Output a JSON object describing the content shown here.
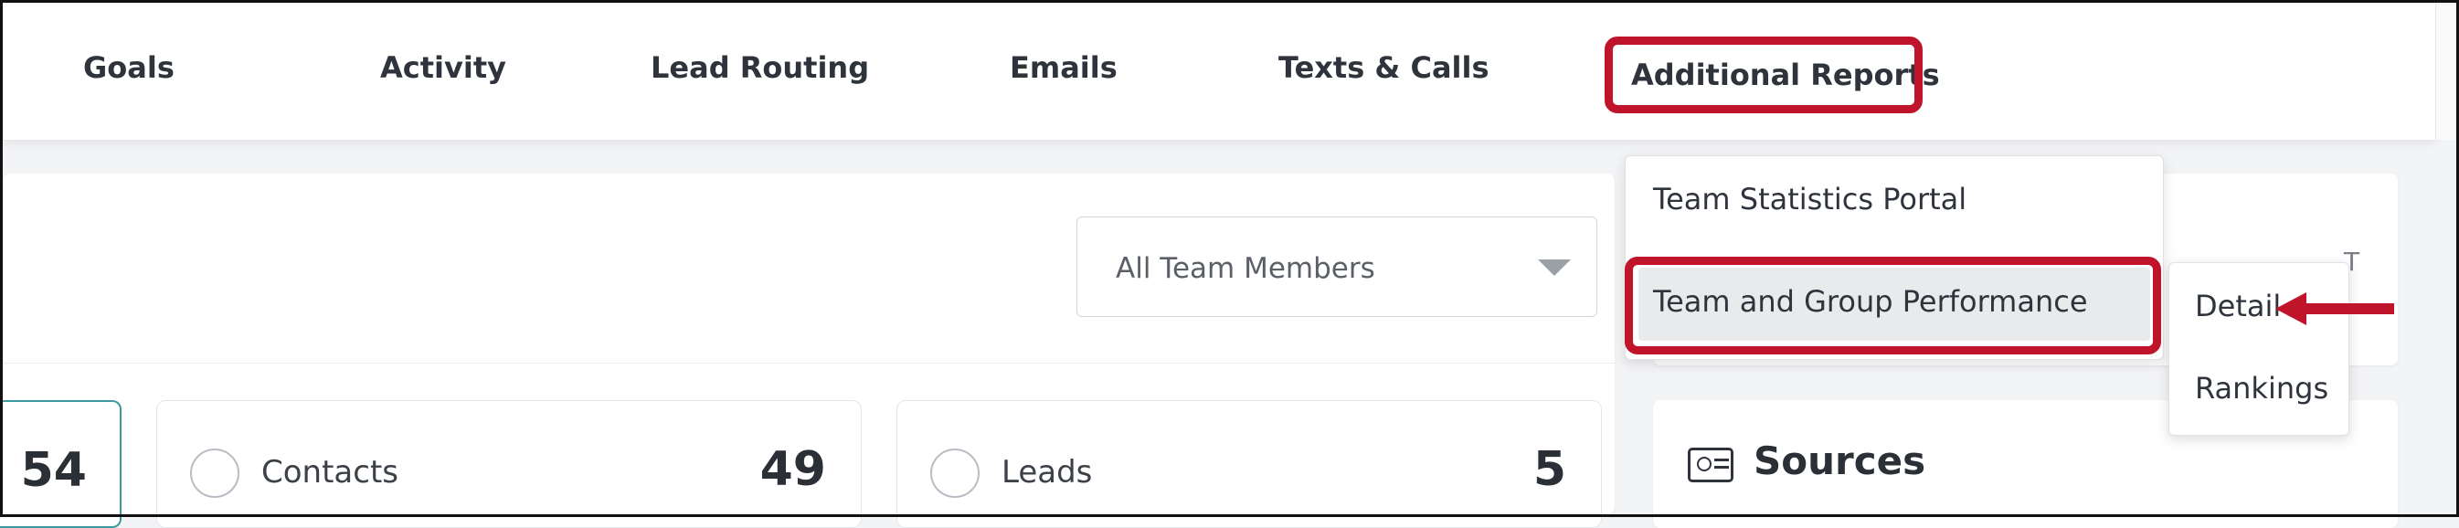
{
  "nav": {
    "items": [
      "Goals",
      "Activity",
      "Lead Routing",
      "Emails",
      "Texts & Calls",
      "Additional Reports"
    ]
  },
  "filter": {
    "selected": "All Team Members"
  },
  "stats": [
    {
      "label": "",
      "value": "54"
    },
    {
      "label": "Contacts",
      "value": "49"
    },
    {
      "label": "Leads",
      "value": "5"
    }
  ],
  "right_panel": {
    "peek_text": "T",
    "sources_title": "Sources",
    "sources_icon": "contact-card-icon"
  },
  "dropdown": {
    "items": [
      "Team Statistics Portal",
      "Team and Group Performance"
    ],
    "submenu": [
      "Detail",
      "Rankings"
    ]
  },
  "annotation": {
    "color": "#c0142b"
  }
}
